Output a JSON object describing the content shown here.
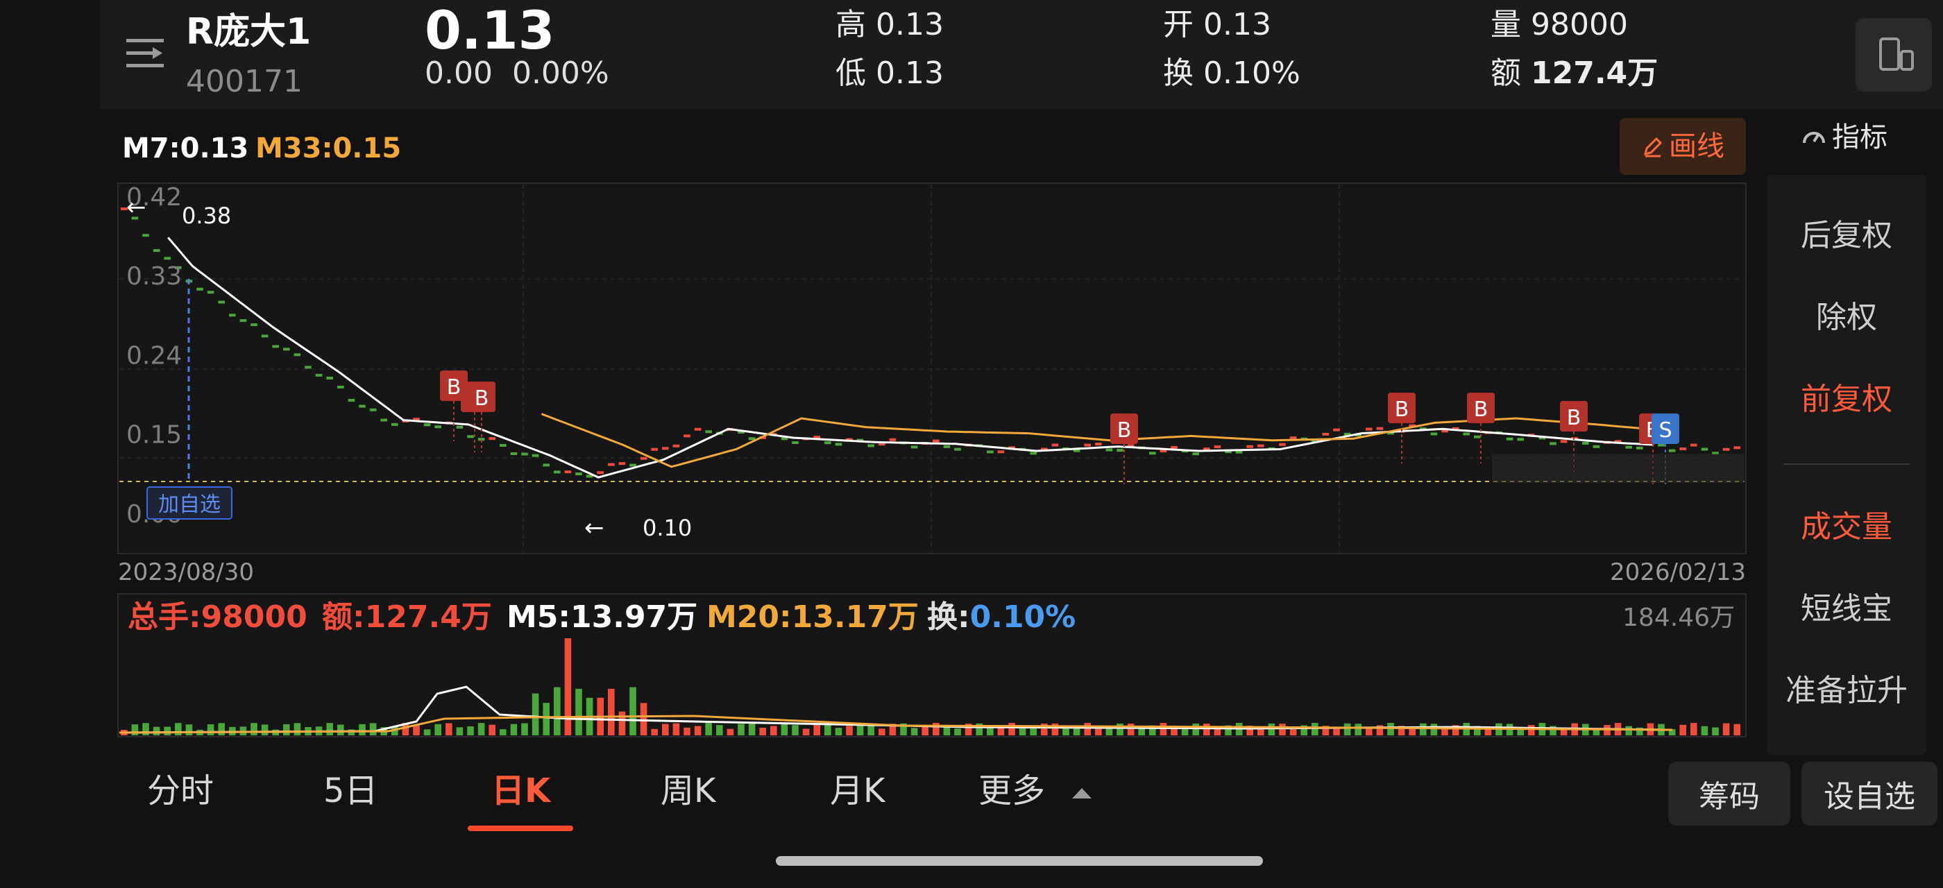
{
  "header": {
    "name": "R庞大1",
    "code": "400171",
    "price": "0.13",
    "change": "0.00",
    "change_pct": "0.00%",
    "stats": [
      {
        "key": "高",
        "value": "0.13"
      },
      {
        "key": "低",
        "value": "0.13"
      },
      {
        "key": "开",
        "value": "0.13"
      },
      {
        "key": "换",
        "value": "0.10%"
      },
      {
        "key": "量",
        "value": "98000"
      },
      {
        "key": "额",
        "value": "127.4万"
      }
    ]
  },
  "indicators": {
    "ma7_label": "M7:0.13",
    "ma33_label": "M33:0.15",
    "draw_label": "画线",
    "indicator_label": "指标"
  },
  "chart": {
    "y_ticks": [
      "0.42",
      "0.33",
      "0.24",
      "0.15",
      "0.06"
    ],
    "y_values": [
      0.42,
      0.33,
      0.24,
      0.15,
      0.06
    ],
    "start_date": "2023/08/30",
    "end_date": "2026/02/13",
    "high_marker": "0.38",
    "low_marker": "0.10",
    "add_watch_badge": "加自选",
    "buy_marker": "B",
    "sell_marker": "S",
    "up_color": "#f14b3a",
    "down_color": "#4aa83a",
    "ma7_color": "#ffffff",
    "ma33_color": "#f3a93a"
  },
  "volume": {
    "total_label": "总手:",
    "total_value": "98000",
    "amount_label": "额:",
    "amount_value": "127.4万",
    "m5_label": "M5:",
    "m5_value": "13.97万",
    "m20_label": "M20:",
    "m20_value": "13.17万",
    "turnover_label": "换:",
    "turnover_value": "0.10%",
    "max_label": "184.46万"
  },
  "side_panel": {
    "items": [
      "后复权",
      "除权",
      "前复权",
      "成交量",
      "短线宝",
      "准备拉升"
    ],
    "active_adjust": "前复权",
    "active_sub": "成交量"
  },
  "tabs": [
    "分时",
    "5日",
    "日K",
    "周K",
    "月K",
    "更多"
  ],
  "active_tab": "日K",
  "bottom_buttons": {
    "chips": "筹码",
    "add_watch": "设自选"
  }
}
